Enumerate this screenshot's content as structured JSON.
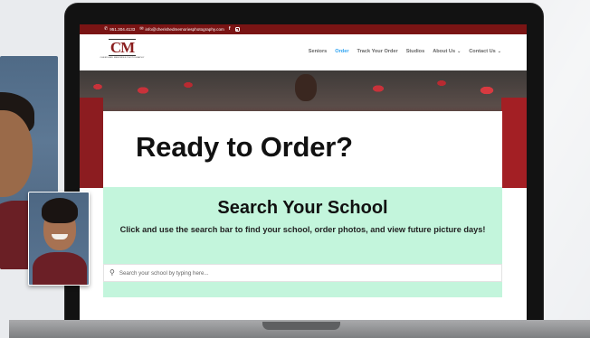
{
  "topbar": {
    "phone": "951.304.4133",
    "email": "info@cherishedmemoriesphotography.com",
    "icons": [
      "phone-icon",
      "email-icon",
      "facebook-icon",
      "instagram-icon"
    ]
  },
  "logo": {
    "mark_c": "C",
    "mark_m": "M",
    "subtitle": "CHERISHED MEMORIES PHOTOGRAPHY"
  },
  "nav": {
    "items": [
      {
        "label": "Seniors"
      },
      {
        "label": "Order"
      },
      {
        "label": "Track Your Order"
      },
      {
        "label": "Studios"
      },
      {
        "label": "About Us"
      },
      {
        "label": "Contact Us"
      }
    ],
    "active": "Order",
    "dropdown_chevron": "⌄"
  },
  "hero": {
    "heading": "Ready to Order?"
  },
  "search": {
    "title": "Search Your School",
    "description": "Click and use the search bar to find your school, order photos, and view future picture days!",
    "placeholder": "Search your school by typing here..."
  },
  "colors": {
    "topbar": "#7a1414",
    "accent_nav": "#2ea3f2",
    "search_section": "#c3f5dc",
    "brand_red": "#8b1e1e"
  }
}
